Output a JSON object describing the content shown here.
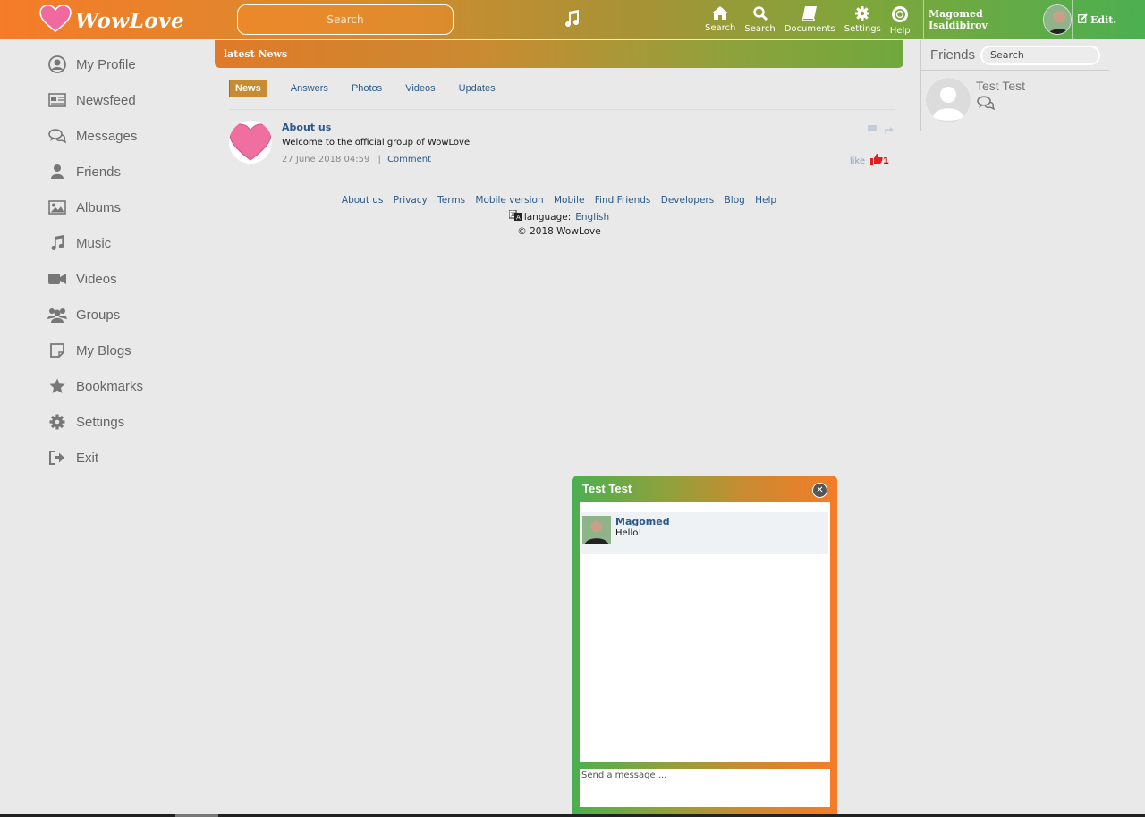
{
  "topbar": {
    "logo_text": "WowLove",
    "search_placeholder": "Search",
    "nav": [
      {
        "label": "Search",
        "icon": "home-icon"
      },
      {
        "label": "Search",
        "icon": "search-icon"
      },
      {
        "label": "Documents",
        "icon": "book-icon"
      },
      {
        "label": "Settings",
        "icon": "gear-icon"
      },
      {
        "label": "Help",
        "icon": "lifebuoy-icon"
      }
    ],
    "user_name": "Magomed Isaldibirov",
    "edit_label": "Edit."
  },
  "sidebar": {
    "items": [
      {
        "label": "My Profile",
        "icon": "user-circle-icon"
      },
      {
        "label": "Newsfeed",
        "icon": "newspaper-icon"
      },
      {
        "label": "Messages",
        "icon": "chat-bubbles-icon"
      },
      {
        "label": "Friends",
        "icon": "user-icon"
      },
      {
        "label": "Albums",
        "icon": "picture-icon"
      },
      {
        "label": "Music",
        "icon": "music-icon"
      },
      {
        "label": "Videos",
        "icon": "video-camera-icon"
      },
      {
        "label": "Groups",
        "icon": "group-icon"
      },
      {
        "label": "My Blogs",
        "icon": "note-icon"
      },
      {
        "label": "Bookmarks",
        "icon": "star-icon"
      },
      {
        "label": "Settings",
        "icon": "gear-icon"
      },
      {
        "label": "Exit",
        "icon": "sign-out-icon"
      }
    ]
  },
  "main": {
    "header": "latest News",
    "tabs": [
      "News",
      "Answers",
      "Photos",
      "Videos",
      "Updates"
    ],
    "active_tab": "News",
    "post": {
      "title": "About us",
      "text": "Welcome to the official group of WowLove",
      "date": "27 June 2018 04:59",
      "separator": "|",
      "comment_label": "Comment",
      "like_label": "like",
      "like_count": "1"
    }
  },
  "footer": {
    "links": [
      "About us",
      "Privacy",
      "Terms",
      "Mobile version",
      "Mobile",
      "Find Friends",
      "Developers",
      "Blog",
      "Help"
    ],
    "language_label": "language:",
    "language_value": "English",
    "copyright": "© 2018 WowLove"
  },
  "friends_panel": {
    "title": "Friends",
    "search_placeholder": "Search",
    "friends": [
      {
        "name": "Test Test"
      }
    ]
  },
  "chat": {
    "title": "Test Test",
    "messages": [
      {
        "author": "Magomed",
        "text": "Hello!"
      }
    ],
    "input_placeholder": "Send a message ..."
  },
  "colors": {
    "gradient_orange": "#f57c28",
    "gradient_green": "#4caf50",
    "link_blue": "#2a5a8a",
    "active_tab": "#c98b31"
  }
}
